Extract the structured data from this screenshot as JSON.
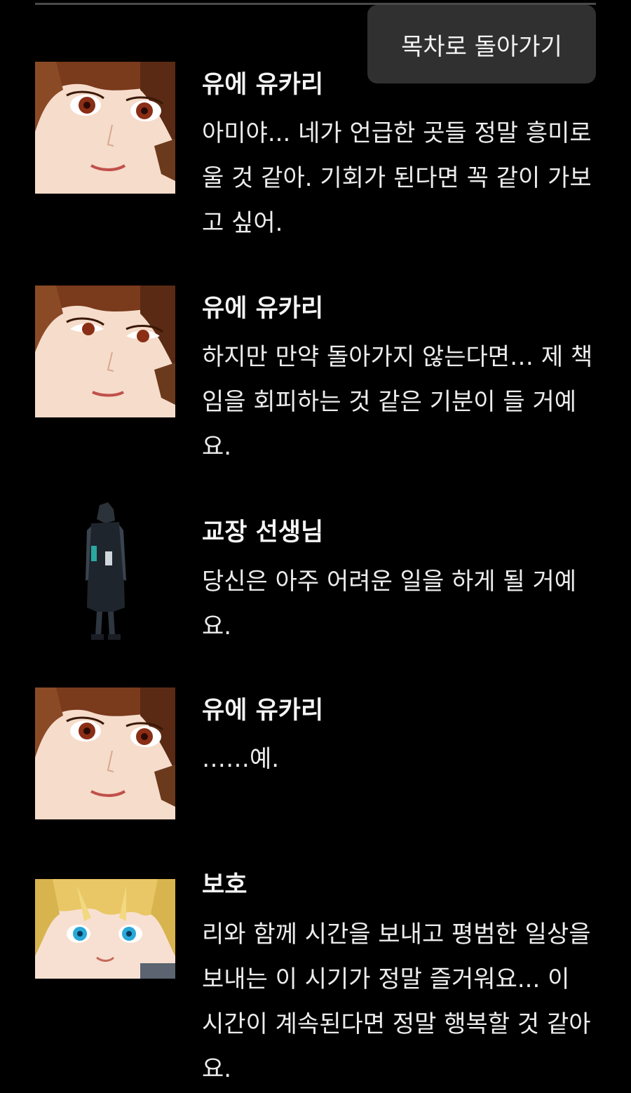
{
  "header": {
    "toc_button_label": "목차로 돌아가기"
  },
  "dialogue": [
    {
      "speaker": "유에 유카리",
      "portrait_icon": "yukari-portrait",
      "text": "아미야... 네가 언급한 곳들 정말 흥미로울 것 같아. 기회가 된다면 꼭 같이 가보고 싶어."
    },
    {
      "speaker": "유에 유카리",
      "portrait_icon": "yukari-portrait",
      "text": "하지만 만약 돌아가지 않는다면… 제 책임을 회피하는 것 같은 기분이 들 거예요."
    },
    {
      "speaker": "교장 선생님",
      "portrait_icon": "principal-figure",
      "text": "당신은 아주 어려운 일을 하게 될 거예요."
    },
    {
      "speaker": "유에 유카리",
      "portrait_icon": "yukari-portrait",
      "text": "……예."
    },
    {
      "speaker": "보호",
      "portrait_icon": "boho-portrait",
      "text": "리와 함께 시간을 보내고 평범한 일상을 보내는 이 시기가 정말 즐거워요... 이 시간이 계속된다면 정말 행복할 것 같아요."
    }
  ],
  "colors": {
    "background": "#000000",
    "button_bg": "#303030",
    "text": "#ececec"
  }
}
